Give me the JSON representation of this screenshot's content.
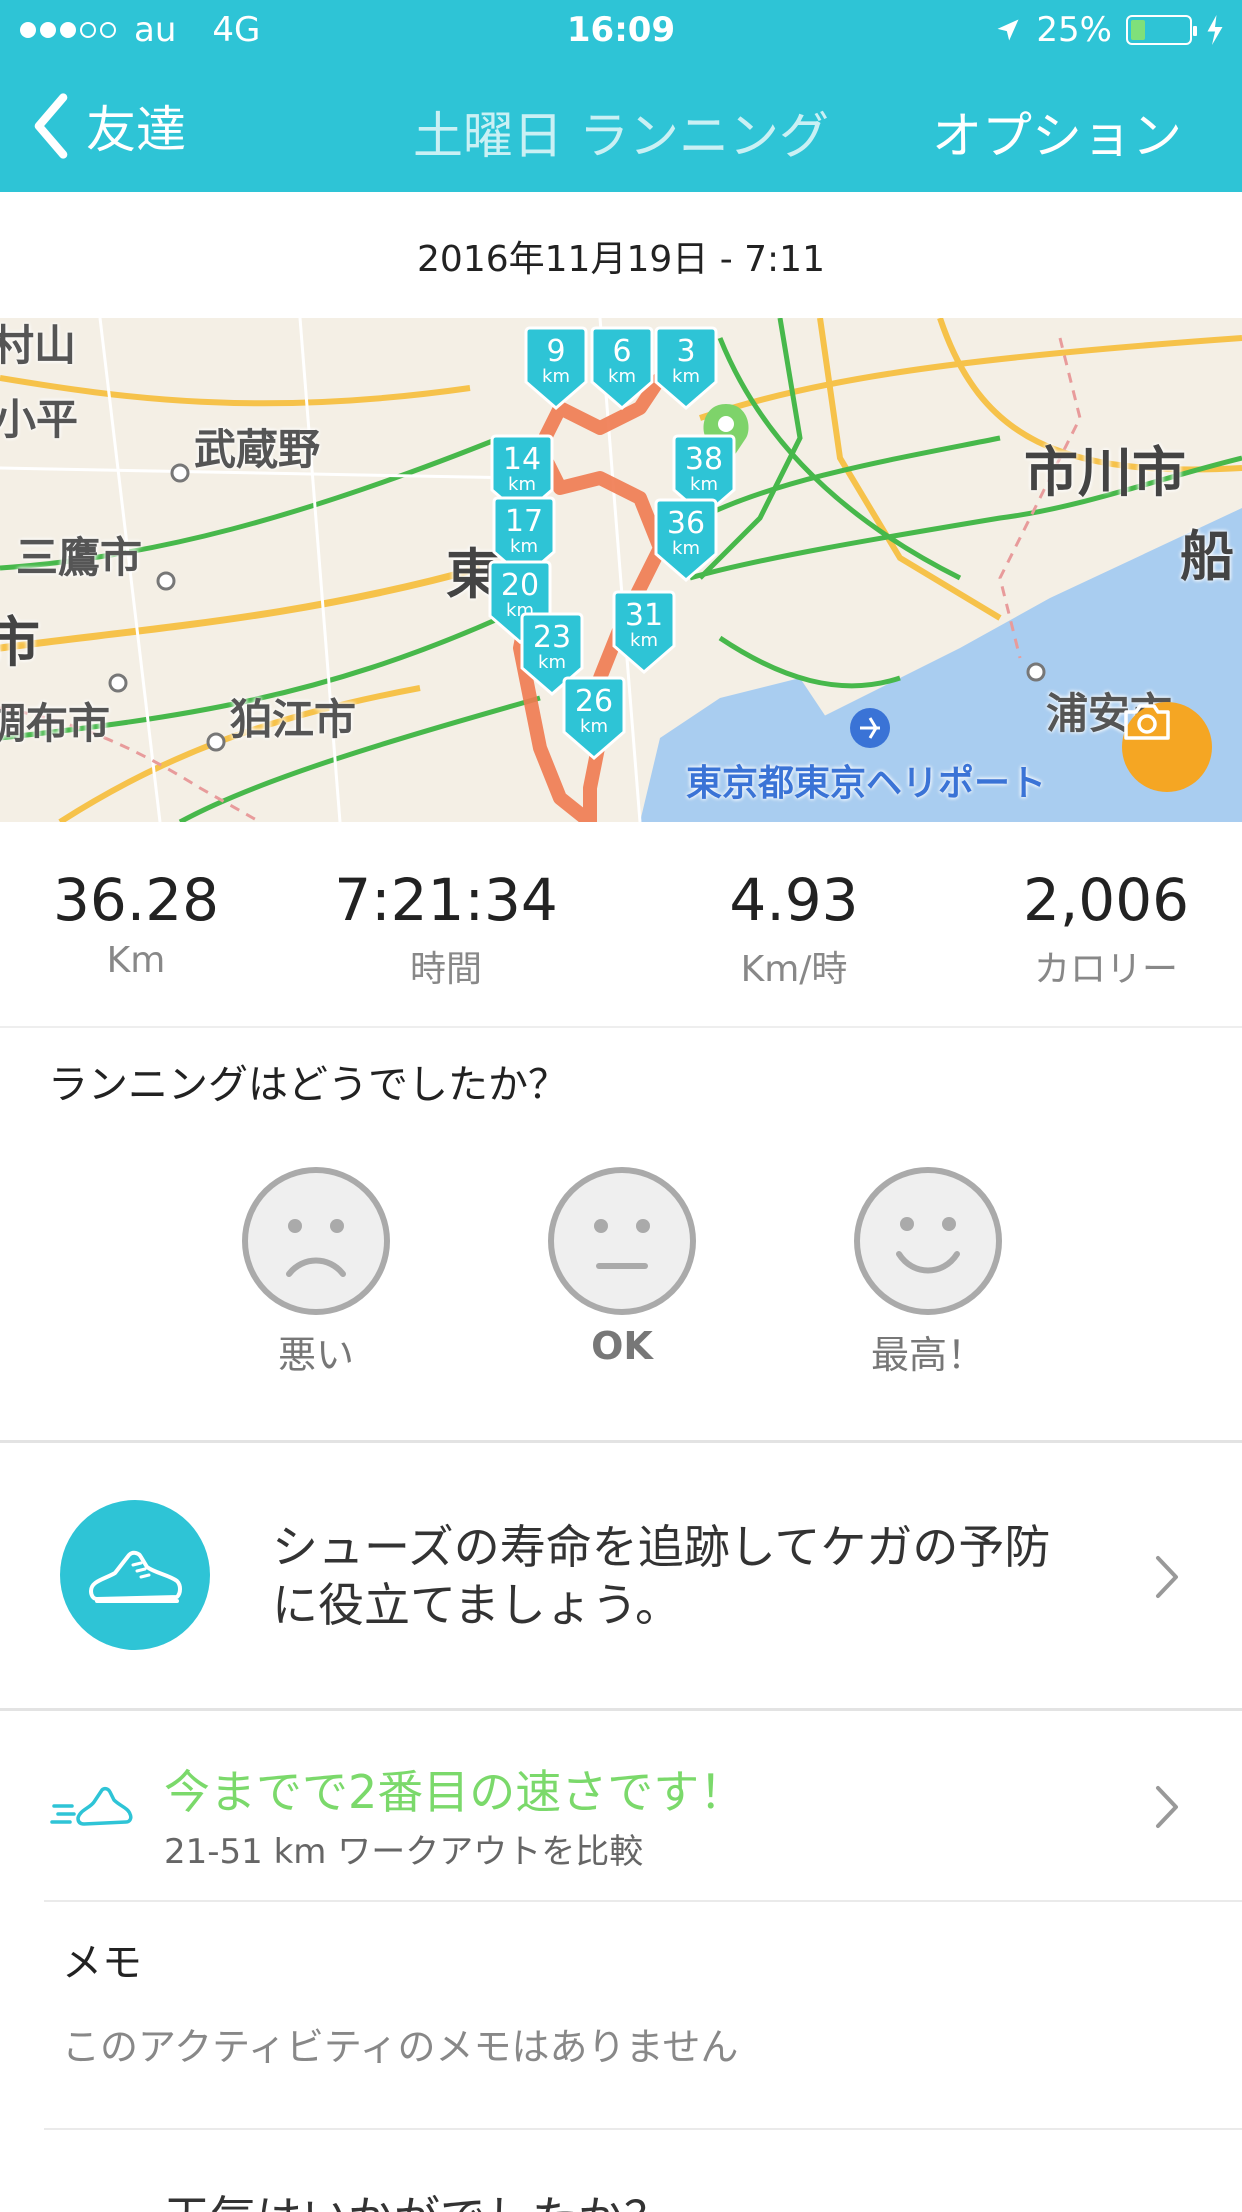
{
  "status_bar": {
    "carrier": "au",
    "network": "4G",
    "time": "16:09",
    "battery": "25%"
  },
  "nav": {
    "back_label": "友達",
    "title": "土曜日 ランニング",
    "options_label": "オプション"
  },
  "activity": {
    "date": "2016年11月19日 - 7:11"
  },
  "map": {
    "place_labels": [
      "村山",
      "小平",
      "武蔵野",
      "三鷹市",
      "市",
      "調布市",
      "狛江市",
      "東",
      "市川市",
      "船",
      "浦安市",
      "東京都東京ヘリポート"
    ],
    "markers": [
      {
        "km": "9",
        "unit": "km"
      },
      {
        "km": "6",
        "unit": "km"
      },
      {
        "km": "3",
        "unit": "km"
      },
      {
        "km": "14",
        "unit": "km"
      },
      {
        "km": "38",
        "unit": "km"
      },
      {
        "km": "36",
        "unit": "km"
      },
      {
        "km": "17",
        "unit": "km"
      },
      {
        "km": "20",
        "unit": "km"
      },
      {
        "km": "31",
        "unit": "km"
      },
      {
        "km": "23",
        "unit": "km"
      },
      {
        "km": "26",
        "unit": "km"
      }
    ],
    "colors": {
      "marker": "#2ec4d6",
      "route": "#f07a50",
      "start_pin": "#7ed36a",
      "water": "#a9cdf0",
      "camera": "#f5a623"
    }
  },
  "stats": [
    {
      "value": "36.28",
      "label": "Km"
    },
    {
      "value": "7:21:34",
      "label": "時間"
    },
    {
      "value": "4.93",
      "label": "Km/時"
    },
    {
      "value": "2,006",
      "label": "カロリー"
    }
  ],
  "feedback": {
    "question": "ランニングはどうでしたか？",
    "options": [
      "悪い",
      "OK",
      "最高！"
    ]
  },
  "shoe_tracker": {
    "text_line1": "シューズの寿命を追跡してケガの予防",
    "text_line2": "に役立てましょう。"
  },
  "performance": {
    "title": "今までで2番目の速さです！",
    "subtitle": "21-51 km ワークアウトを比較"
  },
  "memo": {
    "label": "メモ",
    "placeholder": "このアクティビティのメモはありません"
  },
  "weather": {
    "question": "天気はいかがでしたか？"
  },
  "colors": {
    "accent": "#2ec4d6",
    "highlight_green": "#7bd96b"
  }
}
